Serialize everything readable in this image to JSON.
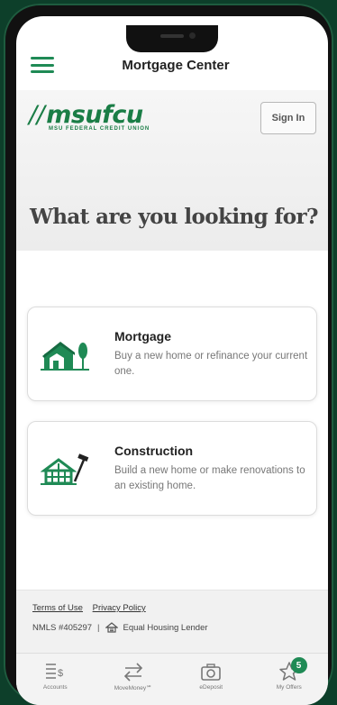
{
  "header": {
    "title": "Mortgage Center"
  },
  "brand": {
    "logo_text": "msufcu",
    "tagline": "MSU FEDERAL CREDIT UNION"
  },
  "signin": {
    "label": "Sign In"
  },
  "hero": {
    "headline": "What are you looking for?"
  },
  "options": [
    {
      "title": "Mortgage",
      "description": "Buy a new home or refinance your current one.",
      "icon": "house-tree-icon"
    },
    {
      "title": "Construction",
      "description": "Build a new home or make renovations to an existing home.",
      "icon": "house-hammer-icon"
    }
  ],
  "footer": {
    "terms": "Terms of Use",
    "privacy": "Privacy Policy",
    "nmls": "NMLS #405297",
    "separator": "|",
    "equal_housing": "Equal Housing Lender"
  },
  "tabs": [
    {
      "label": "Accounts",
      "icon": "accounts-icon"
    },
    {
      "label": "MoveMoney℠",
      "icon": "transfer-arrows-icon"
    },
    {
      "label": "eDeposit",
      "icon": "camera-icon"
    },
    {
      "label": "My Offers",
      "icon": "star-icon",
      "badge": "5"
    }
  ],
  "colors": {
    "brand_green": "#1a7d46",
    "phone_background": "#0d3f2a"
  }
}
